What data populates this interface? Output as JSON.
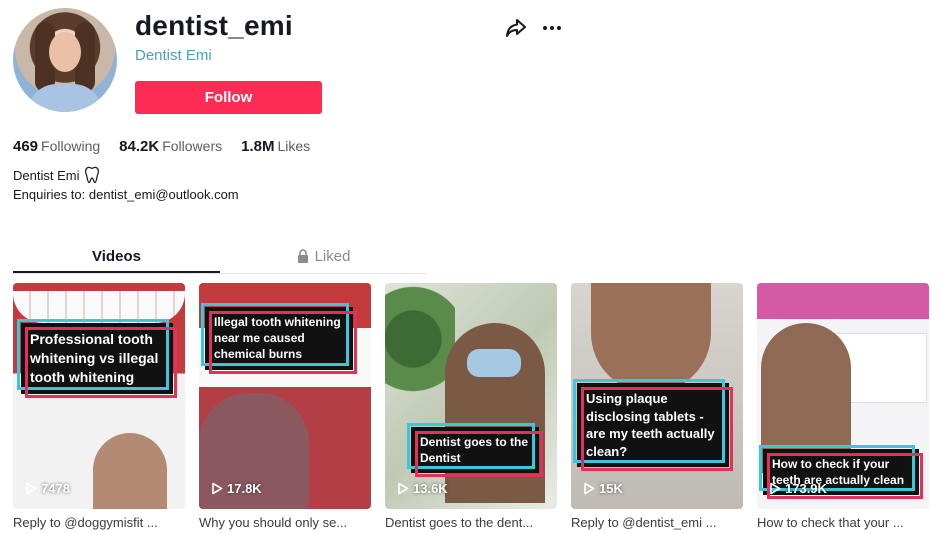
{
  "profile": {
    "username": "dentist_emi",
    "nickname": "Dentist Emi",
    "follow_label": "Follow"
  },
  "stats": [
    {
      "value": "469",
      "label": "Following"
    },
    {
      "value": "84.2K",
      "label": "Followers"
    },
    {
      "value": "1.8M",
      "label": "Likes"
    }
  ],
  "bio": {
    "line1": "Dentist Emi",
    "line2": "Enquiries to: dentist_emi@outlook.com"
  },
  "tabs": [
    {
      "label": "Videos",
      "active": true
    },
    {
      "label": "Liked",
      "active": false
    }
  ],
  "videos": [
    {
      "caption": "Professional tooth whitening vs illegal tooth whitening",
      "views": "7478",
      "description": "Reply to @doggymisfit ..."
    },
    {
      "caption": "Illegal tooth whitening near me caused chemical burns",
      "views": "17.8K",
      "description": "Why you should only se..."
    },
    {
      "caption": "Dentist goes to the Dentist",
      "views": "13.6K",
      "description": "Dentist goes to the dent..."
    },
    {
      "caption": "Using plaque disclosing tablets - are my teeth actually clean?",
      "views": "15K",
      "description": "Reply to @dentist_emi ..."
    },
    {
      "caption": "How to check if your teeth are actually clean",
      "views": "173.9K",
      "description": "How to check that your ..."
    }
  ],
  "colors": {
    "accent": "#fe2c55",
    "nickname": "#4aa1c0",
    "caption_cyan": "#38c7dd",
    "caption_pink": "#e6305c"
  },
  "icons": {
    "share": "share-arrow-icon",
    "more": "more-dots-icon",
    "tooth": "tooth-icon",
    "lock": "lock-icon",
    "play": "play-icon"
  }
}
